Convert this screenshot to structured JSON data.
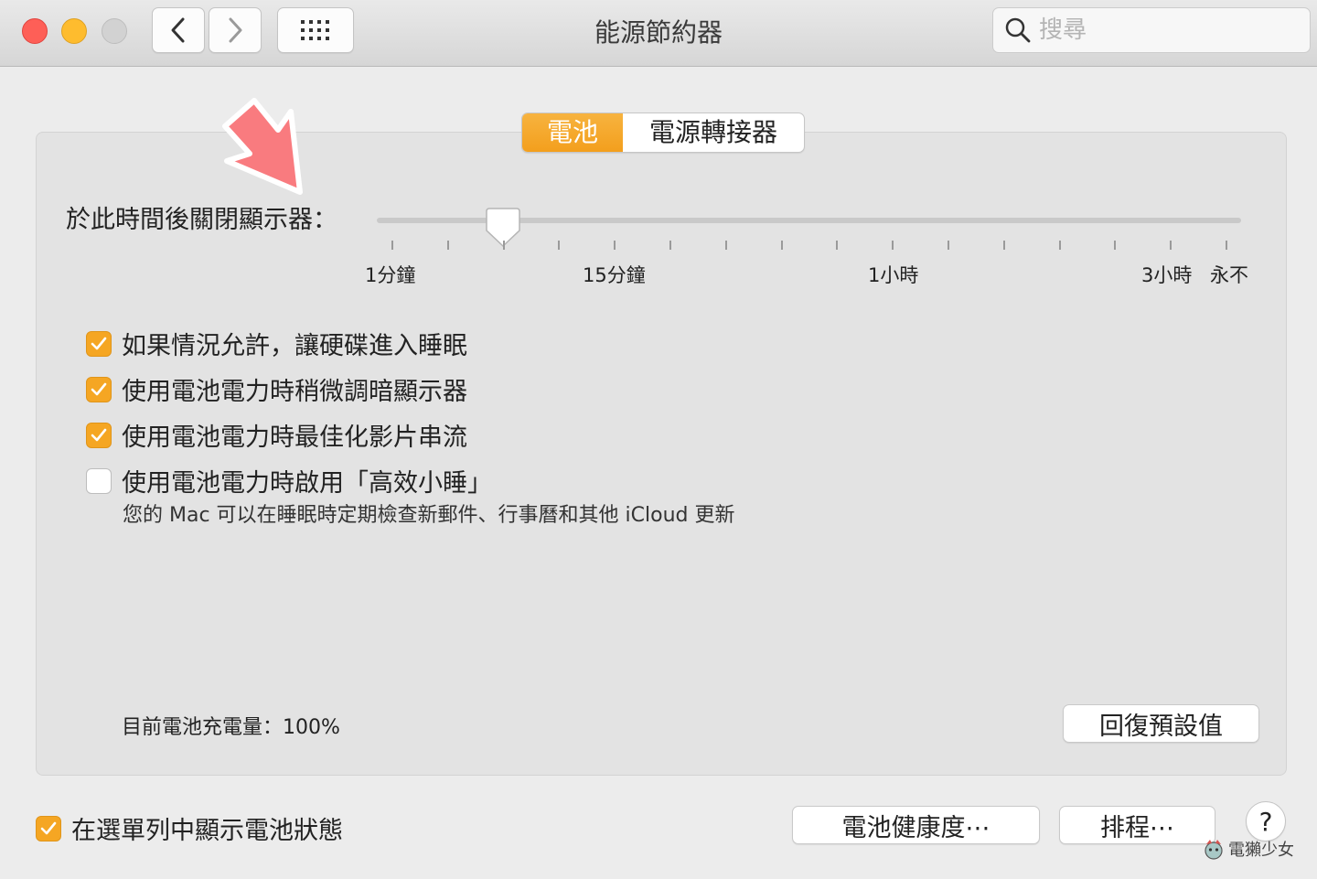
{
  "window": {
    "title": "能源節約器",
    "search_placeholder": "搜尋"
  },
  "tabs": {
    "battery": "電池",
    "power_adapter": "電源轉接器",
    "active": "battery"
  },
  "display_sleep": {
    "label": "於此時間後關閉顯示器：",
    "tick_labels": [
      "1分鐘",
      "15分鐘",
      "1小時",
      "3小時",
      "永不"
    ],
    "value": "5分鐘"
  },
  "options": [
    {
      "label": "如果情況允許，讓硬碟進入睡眠",
      "checked": true
    },
    {
      "label": "使用電池電力時稍微調暗顯示器",
      "checked": true
    },
    {
      "label": "使用電池電力時最佳化影片串流",
      "checked": true
    },
    {
      "label": "使用電池電力時啟用「高效小睡」",
      "checked": false
    }
  ],
  "power_nap_note": "您的 Mac 可以在睡眠時定期檢查新郵件、行事曆和其他 iCloud 更新",
  "battery_charge": "目前電池充電量：100%",
  "buttons": {
    "restore_defaults": "回復預設值",
    "battery_health": "電池健康度⋯",
    "schedule": "排程⋯",
    "help": "?"
  },
  "show_in_menubar": {
    "label": "在選單列中顯示電池狀態",
    "checked": true
  },
  "watermark": "電獺少女",
  "colors": {
    "accent": "#f5a623",
    "annotation_arrow": "#f97b7f"
  },
  "icons": {
    "back": "chevron-left-icon",
    "forward": "chevron-right-icon",
    "grid": "grid-icon",
    "search": "magnifier-icon",
    "check": "checkmark-icon",
    "arrow": "annotation-arrow-icon"
  }
}
